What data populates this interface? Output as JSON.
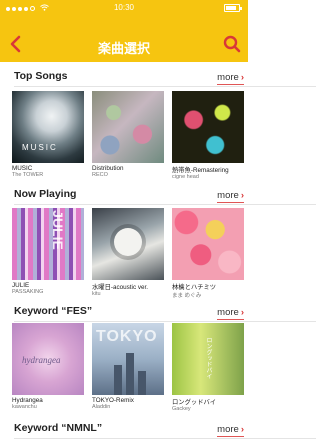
{
  "status": {
    "time": "10:30",
    "battery_level": 0.8
  },
  "header": {
    "title": "楽曲選択",
    "back_icon": "chevron-left-icon",
    "search_icon": "search-icon",
    "accent_color": "#f6c510",
    "icon_color": "#d83838"
  },
  "more_label": "more",
  "sections": [
    {
      "label": "Top Songs",
      "items": [
        {
          "title": "MUSIC",
          "artist": "The TOWER",
          "art_text": "MUSIC"
        },
        {
          "title": "Distribution",
          "artist": "RECO"
        },
        {
          "title": "熱帯魚-Remastering",
          "artist": "cigne head"
        }
      ]
    },
    {
      "label": "Now Playing",
      "items": [
        {
          "title": "JULIE",
          "artist": "PASSAKING",
          "art_text": "JULIE"
        },
        {
          "title": "水曜日-acoustic ver.",
          "artist": "kitu"
        },
        {
          "title": "林檎とハチミツ",
          "artist": "まま めぐみ"
        }
      ]
    },
    {
      "label": "Keyword “FES”",
      "items": [
        {
          "title": "Hydrangea",
          "artist": "kawanchu",
          "art_text": "hydrangea"
        },
        {
          "title": "TOKYO-Remix",
          "artist": "Aladdin",
          "art_text": "TOKYO"
        },
        {
          "title": "ロングッドバイ",
          "artist": "Gackey",
          "art_text": "ロングッドバイ"
        }
      ]
    },
    {
      "label": "Keyword “NMNL”"
    }
  ]
}
